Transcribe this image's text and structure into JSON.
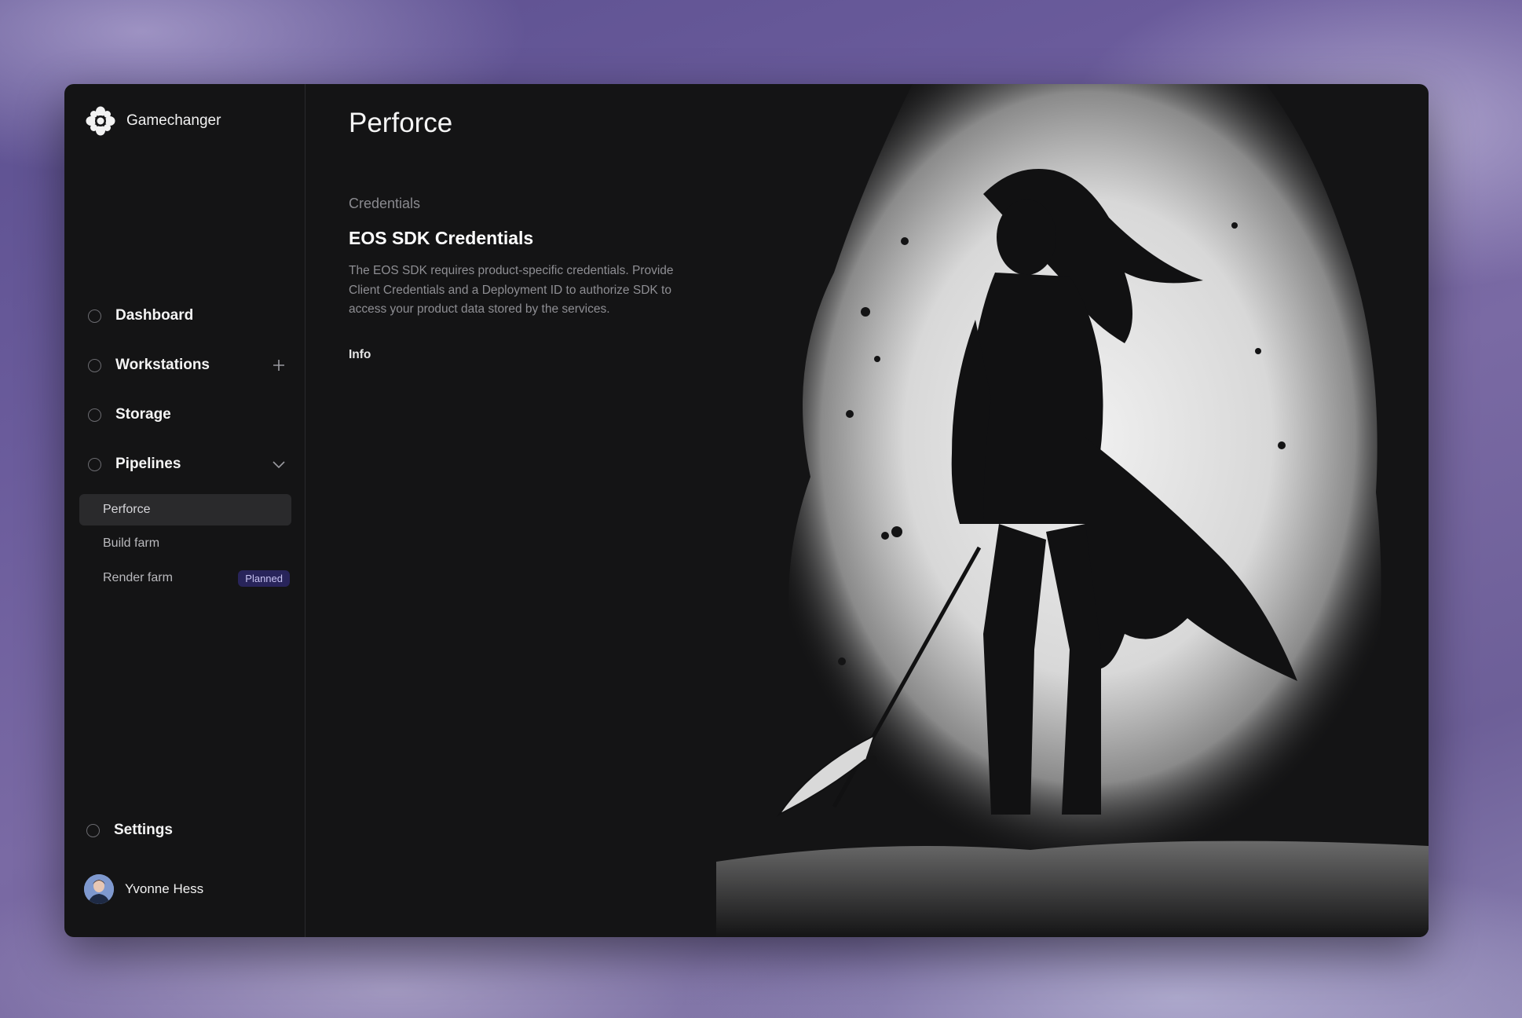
{
  "app": {
    "name": "Gamechanger",
    "logo_icon": "flower-logo-icon"
  },
  "sidebar": {
    "items": [
      {
        "label": "Dashboard",
        "icon": "radio-circle-icon"
      },
      {
        "label": "Workstations",
        "icon": "radio-circle-icon",
        "action_icon": "plus-icon"
      },
      {
        "label": "Storage",
        "icon": "radio-circle-icon"
      },
      {
        "label": "Pipelines",
        "icon": "radio-circle-icon",
        "action_icon": "chevron-down-icon",
        "expanded": true
      }
    ],
    "subitems": [
      {
        "label": "Perforce",
        "active": true
      },
      {
        "label": "Build farm",
        "active": false
      },
      {
        "label": "Render farm",
        "active": false,
        "badge": "Planned"
      }
    ],
    "settings_label": "Settings",
    "user": {
      "name": "Yvonne Hess"
    }
  },
  "main": {
    "title": "Perforce",
    "section_label": "Credentials",
    "card_title": "EOS SDK Credentials",
    "card_description": "The EOS SDK requires product-specific credentials. Provide Client Credentials and a Deployment ID to authorize SDK to access your product data stored by the services.",
    "info_label": "Info",
    "hero_image": "samurai-warrior-ink-illustration"
  },
  "colors": {
    "window_bg": "#141415",
    "accent_badge_bg": "#28245a",
    "accent_badge_text": "#c9c4f2",
    "active_row_bg": "#2a2a2c"
  }
}
